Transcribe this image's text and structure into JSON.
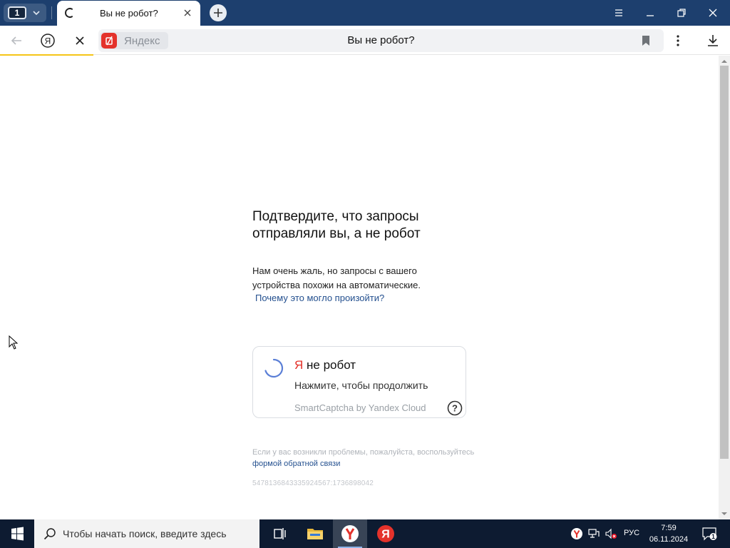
{
  "browser": {
    "tab_count": "1",
    "tab": {
      "title": "Вы не робот?"
    },
    "address": {
      "site_name": "Яндекс",
      "page_title": "Вы не робот?"
    }
  },
  "page": {
    "heading": "Подтвердите, что запросы отправляли вы, а не робот",
    "paragraph": "Нам очень жаль, но запросы с вашего устройства похожи на автоматические.",
    "why_link": "Почему это могло произойти?",
    "captcha": {
      "title_ya": "Я",
      "title_rest": " не робот",
      "subtitle": "Нажмите, чтобы продолжить",
      "brand": "SmartCaptcha by Yandex Cloud"
    },
    "footnote_text": "Если у вас возникли проблемы, пожалуйста, воспользуйтесь ",
    "feedback_link": "формой обратной связи",
    "request_id": "5478136843335924567:1736898042"
  },
  "taskbar": {
    "search_placeholder": "Чтобы начать поиск, введите здесь",
    "language": "РУС",
    "time": "7:59",
    "date": "06.11.2024",
    "notification_count": "1"
  },
  "colors": {
    "titlebar": "#1d3f6e",
    "yandex_red": "#e4322b",
    "link": "#24508f",
    "loading_bar": "#f5c518",
    "taskbar": "#0d1b31"
  }
}
